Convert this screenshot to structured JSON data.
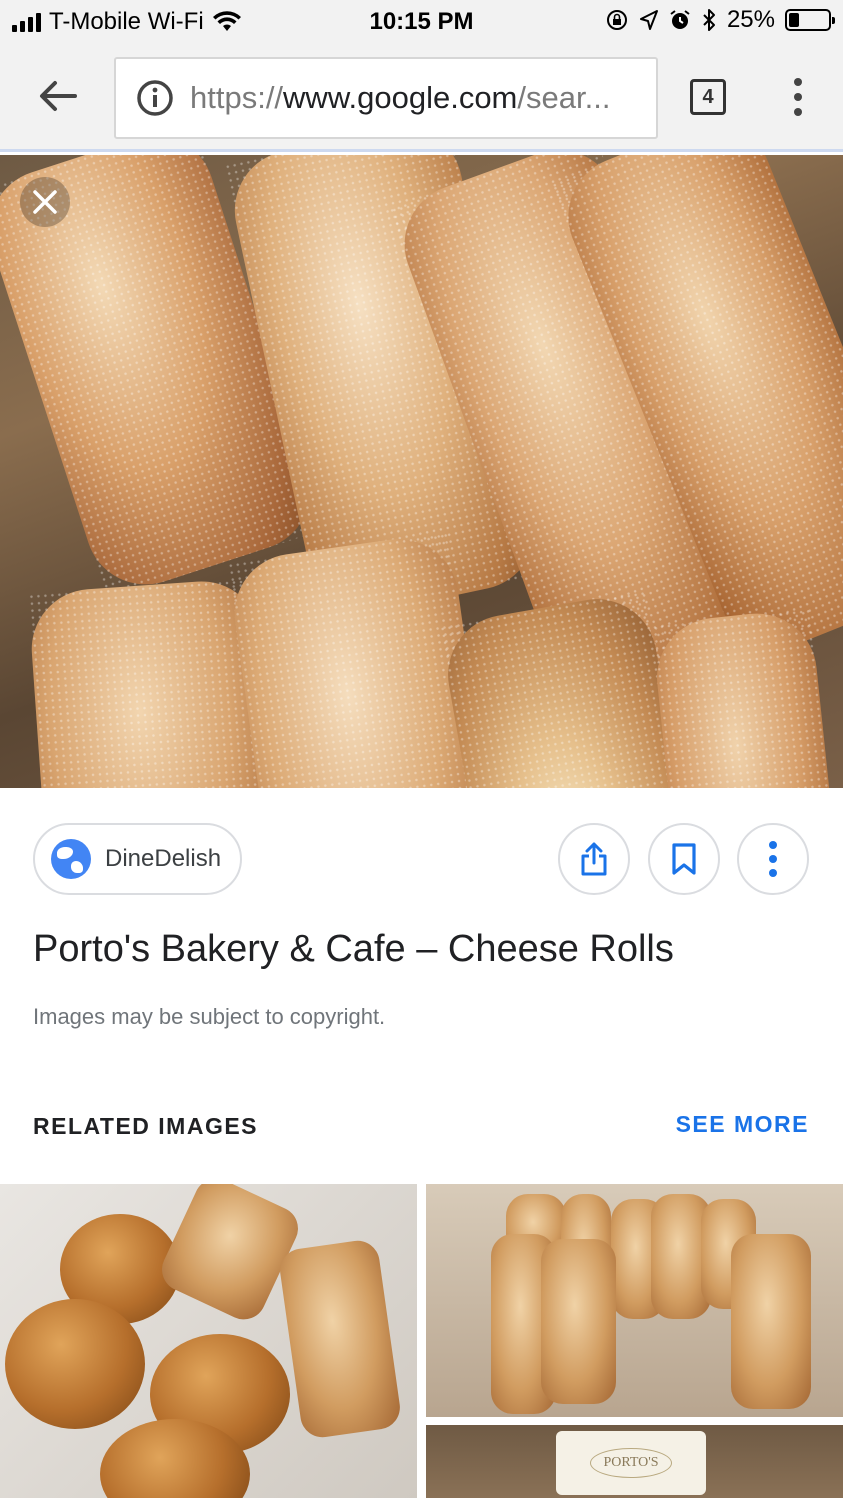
{
  "status_bar": {
    "carrier": "T-Mobile Wi-Fi",
    "time": "10:15 PM",
    "battery_percent": "25%",
    "battery_level": 0.25,
    "icons": [
      "signal-icon",
      "wifi-icon",
      "rotation-lock-icon",
      "location-icon",
      "alarm-icon",
      "bluetooth-icon",
      "battery-icon"
    ]
  },
  "browser": {
    "url_scheme": "https://",
    "url_host": "www.google.com",
    "url_path": "/sear...",
    "tab_count": "4",
    "icons": [
      "back-arrow-icon",
      "info-icon",
      "more-vert-icon"
    ]
  },
  "viewer": {
    "source_name": "DineDelish",
    "title": "Porto's Bakery & Cafe – Cheese Rolls",
    "copyright_notice": "Images may be subject to copyright.",
    "actions": [
      "share-icon",
      "bookmark-icon",
      "more-vert-icon"
    ]
  },
  "related": {
    "heading": "RELATED IMAGES",
    "see_more": "SEE MORE",
    "thumb3_label": "PORTO'S"
  },
  "colors": {
    "accent": "#1a73e8",
    "toolbar_bg": "#f2f2f2",
    "text_primary": "#202124",
    "text_secondary": "#70757a"
  }
}
